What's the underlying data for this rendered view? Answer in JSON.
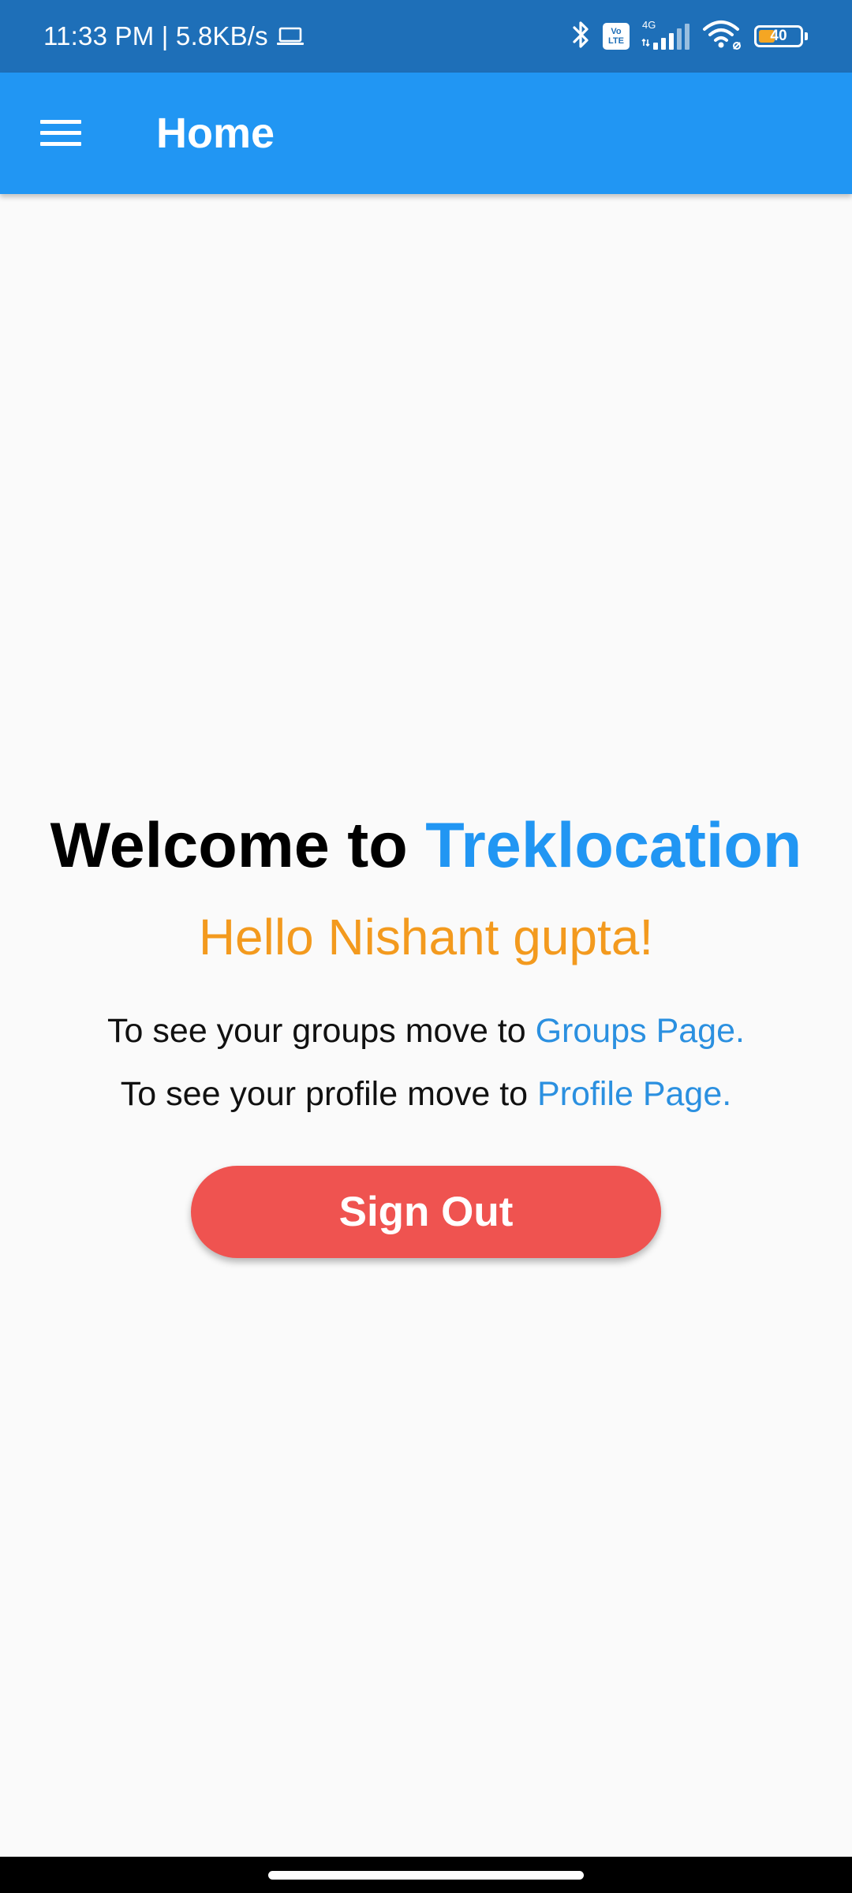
{
  "status_bar": {
    "time_and_speed": "11:33 PM | 5.8KB/s",
    "volte_top": "Vo",
    "volte_bottom": "LTE",
    "network_type": "4G",
    "battery_level": "40",
    "battery_fraction": 0.4,
    "battery_accent_color": "#f5a623",
    "icons": [
      "laptop-icon",
      "bluetooth-icon",
      "volte-icon",
      "signal-icon",
      "wifi-icon",
      "battery-icon"
    ]
  },
  "app_bar": {
    "title": "Home",
    "background_color": "#2196f3",
    "menu_icon": "hamburger-menu-icon"
  },
  "main": {
    "welcome_prefix": "Welcome to ",
    "brand_name": "Treklocation",
    "greeting": "Hello Nishant gupta!",
    "groups_text": "To see your groups move to ",
    "groups_link": "Groups Page.",
    "profile_text": "To see your profile move to ",
    "profile_link": "Profile Page.",
    "sign_out_label": "Sign Out",
    "brand_color": "#2196f3",
    "greeting_color": "#f39a1e",
    "link_color": "#2b90e0",
    "sign_out_color": "#ef5350"
  }
}
